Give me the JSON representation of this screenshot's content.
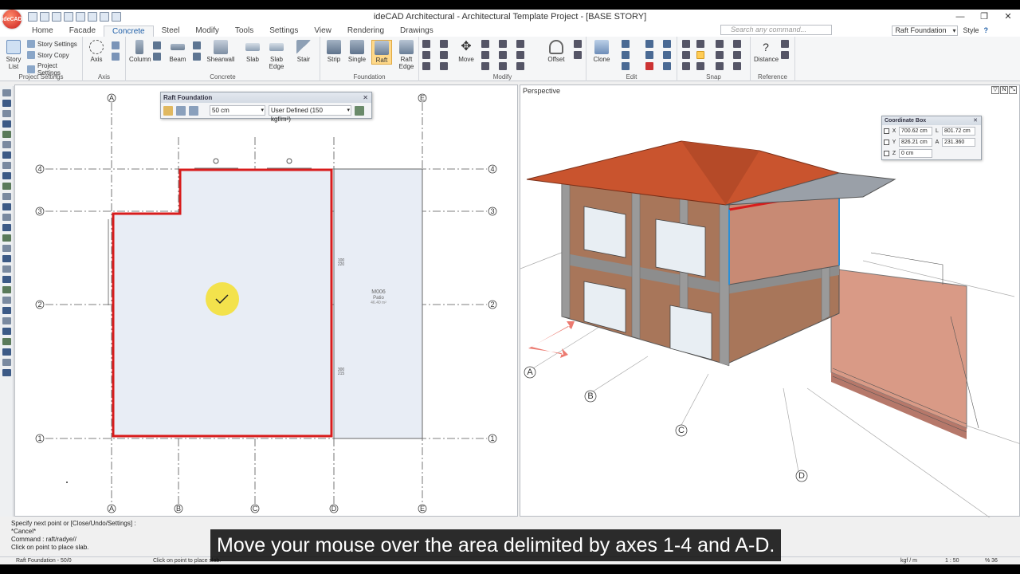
{
  "app": {
    "title": "ideCAD Architectural - Architectural Template Project - [BASE STORY]",
    "logo_text": "ideCAD"
  },
  "window_controls": {
    "minimize": "—",
    "restore": "❐",
    "close": "✕"
  },
  "tabs": [
    "Home",
    "Facade",
    "Concrete",
    "Steel",
    "Modify",
    "Tools",
    "Settings",
    "View",
    "Rendering",
    "Drawings"
  ],
  "active_tab": "Concrete",
  "search": {
    "placeholder": "Search any command..."
  },
  "right_tools": {
    "current_command": "Raft Foundation",
    "style_label": "Style"
  },
  "ribbon": {
    "project_settings": {
      "label": "Project Settings",
      "story_list": "Story List",
      "story_settings": "Story Settings",
      "story_copy": "Story Copy",
      "project_settings_btn": "Project Settings"
    },
    "axis": {
      "label": "Axis",
      "axis_btn": "Axis"
    },
    "concrete": {
      "label": "Concrete",
      "column": "Column",
      "beam": "Beam",
      "shearwall": "Shearwall",
      "slab": "Slab",
      "slab_edge": "Slab Edge",
      "stair": "Stair"
    },
    "foundation": {
      "label": "Foundation",
      "strip": "Strip",
      "single": "Single",
      "raft": "Raft",
      "raft_edge": "Raft Edge"
    },
    "modify": {
      "label": "Modify",
      "move": "Move",
      "offset": "Offset"
    },
    "edit": {
      "label": "Edit",
      "clone": "Clone"
    },
    "snap": {
      "label": "Snap"
    },
    "reference": {
      "label": "Reference",
      "distance": "Distance"
    }
  },
  "plan": {
    "axes_letters": [
      "A",
      "B",
      "C",
      "D",
      "E"
    ],
    "axes_numbers": [
      "1",
      "2",
      "3",
      "4"
    ],
    "room_label": "M006",
    "room_name": "Patio",
    "room_area": "46.40 m²",
    "dim_1": "100",
    "dim_1b": "220",
    "dim_2": "300",
    "dim_2b": "215"
  },
  "raft_panel": {
    "title": "Raft Foundation",
    "thickness": "50 cm",
    "soil_type": "User Defined  (150 kgf/m²)"
  },
  "perspective": {
    "label": "Perspective",
    "grid_labels": [
      "A",
      "B",
      "C",
      "D"
    ],
    "coord_box": {
      "title": "Coordinate Box",
      "x": "700.62 cm",
      "y": "826.21 cm",
      "z": "0 cm",
      "l": "801.72 cm",
      "a": "231.360"
    }
  },
  "command_line": [
    "Specify next point or [Close/Undo/Settings] :",
    "*Cancel*",
    "Command : raft/radye//",
    "Click on point to place slab."
  ],
  "status_bar": {
    "left": "Raft Foundation - 50/0",
    "hint": "Click on point to place slab.",
    "unit": "kgf / m",
    "scale": "1 : 50",
    "zoom": "% 36"
  },
  "caption": "Move your mouse over the area delimited by axes 1-4 and A-D.",
  "colors": {
    "selection_red": "#d81c1c",
    "raft_fill": "#e8edf5",
    "roof": "#c9542e",
    "wall": "#a8765a",
    "accent_blue": "#1f5fa8"
  }
}
